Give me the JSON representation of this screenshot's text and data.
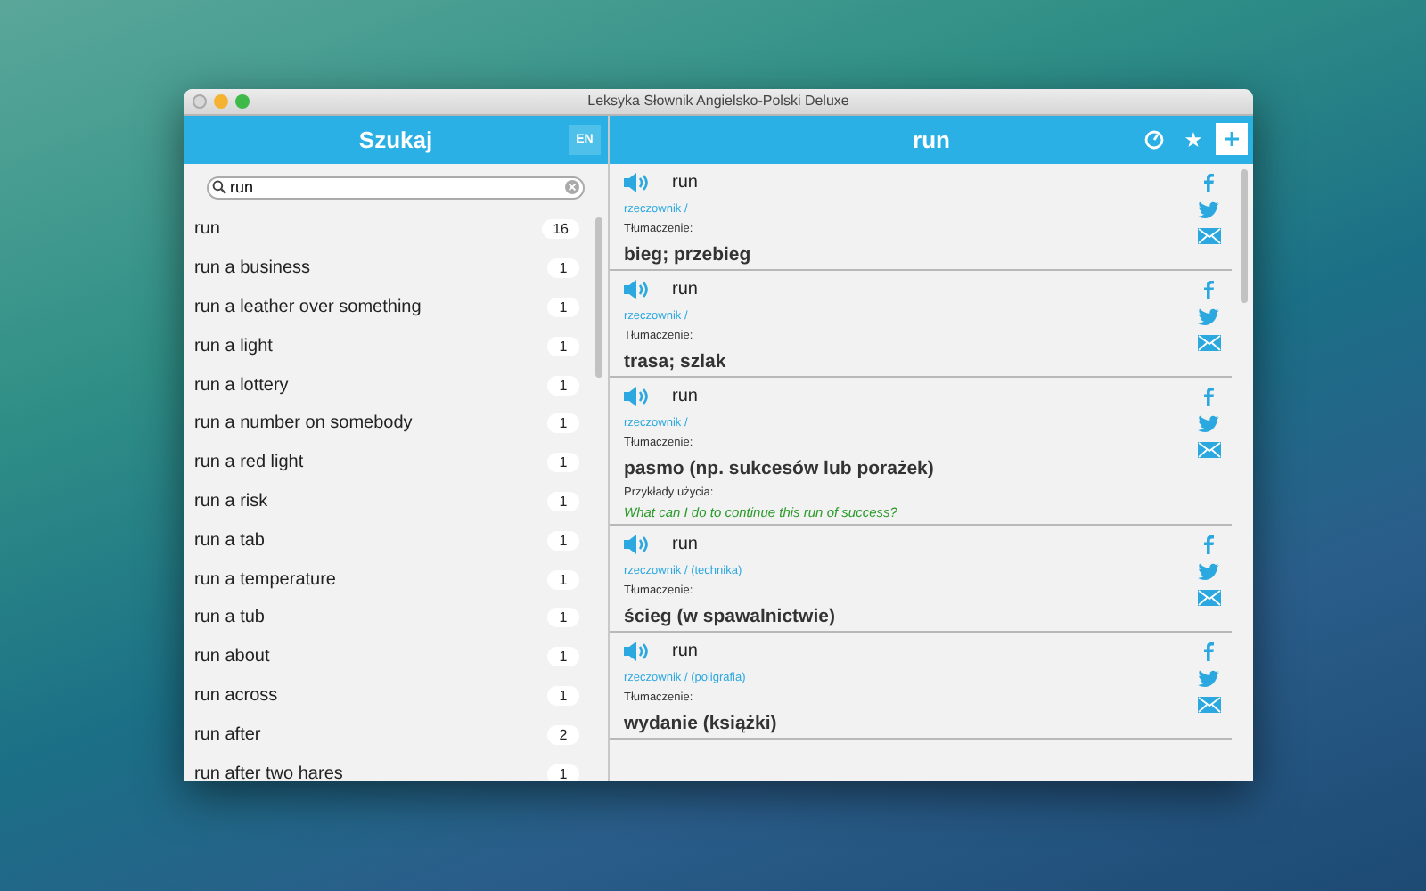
{
  "window": {
    "title": "Leksyka Słownik Angielsko-Polski Deluxe"
  },
  "search_panel": {
    "title": "Szukaj",
    "language_button": "EN",
    "search": {
      "value": "run"
    },
    "results": [
      {
        "term": "run",
        "count": "16"
      },
      {
        "term": "run a business",
        "count": "1"
      },
      {
        "term": "run a leather over something",
        "count": "1"
      },
      {
        "term": "run a light",
        "count": "1"
      },
      {
        "term": "run a lottery",
        "count": "1"
      },
      {
        "term": "run a number on somebody",
        "count": "1"
      },
      {
        "term": "run a red light",
        "count": "1"
      },
      {
        "term": "run a risk",
        "count": "1"
      },
      {
        "term": "run a tab",
        "count": "1"
      },
      {
        "term": "run a temperature",
        "count": "1"
      },
      {
        "term": "run a tub",
        "count": "1"
      },
      {
        "term": "run about",
        "count": "1"
      },
      {
        "term": "run across",
        "count": "1"
      },
      {
        "term": "run after",
        "count": "2"
      },
      {
        "term": "run after two hares",
        "count": "1"
      }
    ]
  },
  "entry_panel": {
    "title": "run",
    "entries": [
      {
        "word": "run",
        "grammar": "rzeczownik /",
        "translation_label": "Tłumaczenie:",
        "translation": "bieg; przebieg"
      },
      {
        "word": "run",
        "grammar": "rzeczownik /",
        "translation_label": "Tłumaczenie:",
        "translation": "trasa; szlak"
      },
      {
        "word": "run",
        "grammar": "rzeczownik /",
        "translation_label": "Tłumaczenie:",
        "translation": "pasmo (np. sukcesów lub porażek)",
        "examples_label": "Przykłady użycia:",
        "example": "What can I do to continue this run of success?"
      },
      {
        "word": "run",
        "grammar": "rzeczownik / (technika)",
        "translation_label": "Tłumaczenie:",
        "translation": "ścieg (w spawalnictwie)"
      },
      {
        "word": "run",
        "grammar": "rzeczownik / (poligrafia)",
        "translation_label": "Tłumaczenie:",
        "translation": "wydanie (książki)"
      }
    ]
  }
}
